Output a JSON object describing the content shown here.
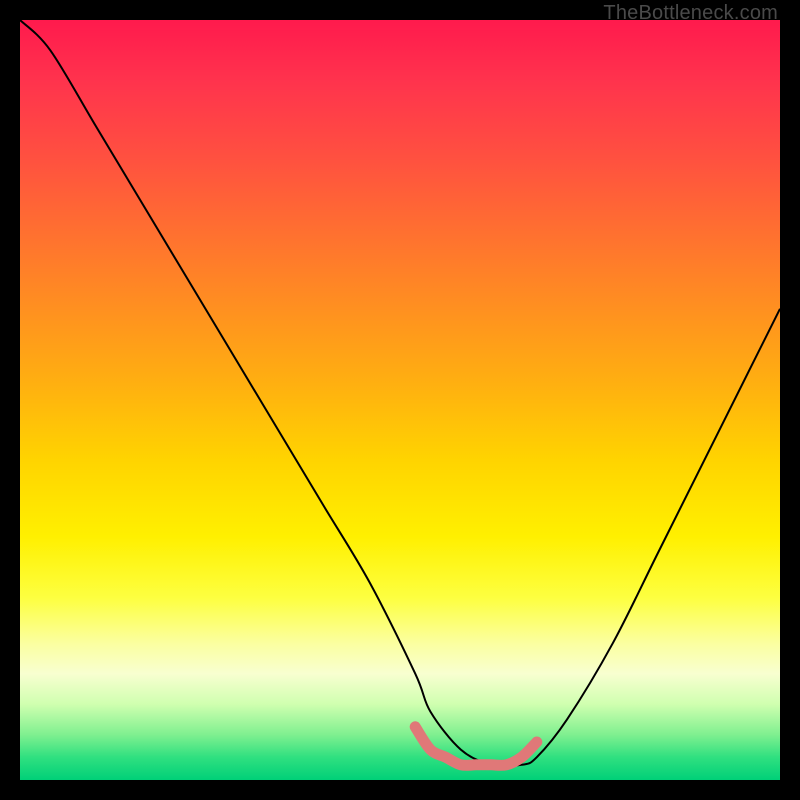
{
  "watermark": "TheBottleneck.com",
  "chart_data": {
    "type": "line",
    "title": "",
    "xlabel": "",
    "ylabel": "",
    "xlim": [
      0,
      100
    ],
    "ylim": [
      0,
      100
    ],
    "gradient_stops": [
      {
        "pos": 0,
        "color": "#ff1a4d"
      },
      {
        "pos": 18,
        "color": "#ff5040"
      },
      {
        "pos": 38,
        "color": "#ff9020"
      },
      {
        "pos": 58,
        "color": "#ffd400"
      },
      {
        "pos": 76,
        "color": "#fdff40"
      },
      {
        "pos": 90,
        "color": "#d0ffb0"
      },
      {
        "pos": 100,
        "color": "#00d078"
      }
    ],
    "series": [
      {
        "name": "bottleneck-curve",
        "color": "#000000",
        "x": [
          0,
          4,
          10,
          16,
          22,
          28,
          34,
          40,
          46,
          52,
          54,
          58,
          62,
          66,
          68,
          72,
          78,
          84,
          90,
          96,
          100
        ],
        "values": [
          100,
          96,
          86,
          76,
          66,
          56,
          46,
          36,
          26,
          14,
          9,
          4,
          2,
          2,
          3,
          8,
          18,
          30,
          42,
          54,
          62
        ]
      },
      {
        "name": "optimal-zone-marker",
        "color": "#e07878",
        "x": [
          52,
          54,
          56,
          58,
          60,
          62,
          64,
          66,
          68
        ],
        "values": [
          7,
          4,
          3,
          2,
          2,
          2,
          2,
          3,
          5
        ]
      }
    ],
    "annotations": []
  }
}
